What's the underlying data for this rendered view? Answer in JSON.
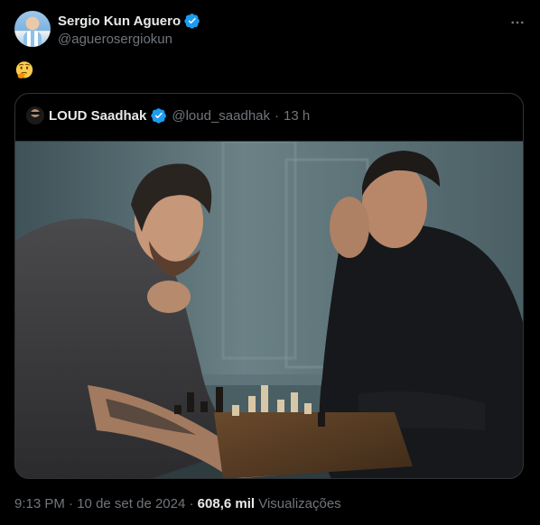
{
  "author": {
    "name": "Sergio Kun Aguero",
    "handle": "@aguerosergiokun",
    "verified_color": "#1d9bf0"
  },
  "tweet": {
    "emoji": "thinking-face",
    "more_icon": "more-horizontal-icon"
  },
  "quoted": {
    "name": "LOUD Saadhak",
    "handle": "@loud_saadhak",
    "separator": "·",
    "time": "13 h",
    "image_alt": "two men playing chess"
  },
  "meta": {
    "time": "9:13 PM",
    "separator1": "·",
    "date": "10 de set de 2024",
    "separator2": "·",
    "views_count": "608,6 mil",
    "views_label": "Visualizações"
  }
}
